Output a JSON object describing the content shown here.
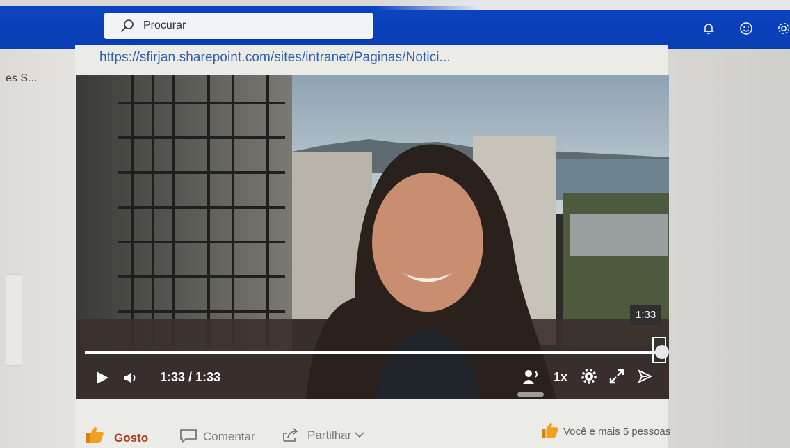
{
  "topbar": {
    "search_placeholder": "Procurar",
    "icons": [
      "bell-icon",
      "smiley-icon",
      "gear-icon"
    ],
    "color": "#0a3eb4"
  },
  "left_pane": {
    "truncated_text": "es S..."
  },
  "post": {
    "link_text": "https://sfirjan.sharepoint.com/sites/intranet/Paginas/Notici..."
  },
  "video": {
    "current_time": "1:33",
    "duration": "1:33",
    "time_display": "1:33 / 1:33",
    "tooltip_time": "1:33",
    "speed": "1x",
    "progress_fraction": 1.0,
    "controls": [
      "play-icon",
      "volume-icon",
      "captions-icon",
      "settings-icon",
      "fullscreen-icon",
      "share-icon"
    ]
  },
  "actions": {
    "like_label": "Gosto",
    "comment_label": "Comentar",
    "share_label": "Partilhar",
    "likes_summary": "Você e mais 5 pessoas"
  },
  "colors": {
    "like_accent": "#b23a1a",
    "link": "#2f5fb0",
    "thumb": "#f0a020"
  }
}
